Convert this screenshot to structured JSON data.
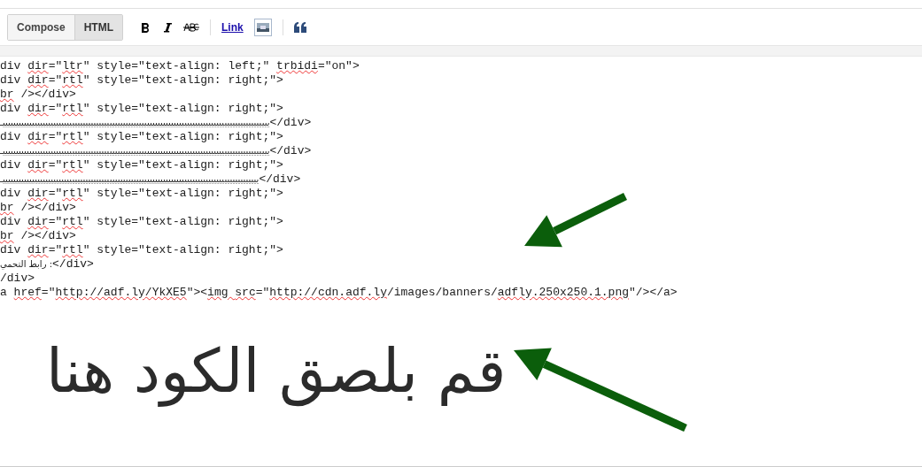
{
  "mode_tabs": [
    {
      "label": "Compose",
      "selected": false
    },
    {
      "label": "HTML",
      "selected": true
    }
  ],
  "toolbar": {
    "link": "Link"
  },
  "code_lines": [
    [
      {
        "text": "div "
      },
      {
        "text": "dir",
        "misspelled": true
      },
      {
        "text": "=\""
      },
      {
        "text": "ltr",
        "misspelled": true
      },
      {
        "text": "\" style=\"text-align: left;\" "
      },
      {
        "text": "trbidi",
        "misspelled": true
      },
      {
        "text": "=\"on\">"
      }
    ],
    [
      {
        "text": "div "
      },
      {
        "text": "dir",
        "misspelled": true
      },
      {
        "text": "=\""
      },
      {
        "text": "rtl",
        "misspelled": true
      },
      {
        "text": "\" style=\"text-align: right;\">"
      }
    ],
    [
      {
        "text": "br",
        "misspelled": true
      },
      {
        "text": " /></div>"
      }
    ],
    [
      {
        "text": "div "
      },
      {
        "text": "dir",
        "misspelled": true
      },
      {
        "text": "=\""
      },
      {
        "text": "rtl",
        "misspelled": true
      },
      {
        "text": "\" style=\"text-align: right;\">"
      }
    ],
    [
      {
        "text": "ییییییییییییییییییییییییییییییییییییییییییییییییییییییییییییییییییییییییییییییییییییییییییییییییییییـ",
        "kind": "arabic"
      },
      {
        "text": "</div>"
      }
    ],
    [
      {
        "text": "div "
      },
      {
        "text": "dir",
        "misspelled": true
      },
      {
        "text": "=\""
      },
      {
        "text": "rtl",
        "misspelled": true
      },
      {
        "text": "\" style=\"text-align: right;\">"
      }
    ],
    [
      {
        "text": "ییییییییییییییییییییییییییییییییییییییییییییییییییییییییییییییییییییییییییییییییییییییییییییییییییییـ",
        "kind": "arabic"
      },
      {
        "text": "</div>"
      }
    ],
    [
      {
        "text": "div "
      },
      {
        "text": "dir",
        "misspelled": true
      },
      {
        "text": "=\""
      },
      {
        "text": "rtl",
        "misspelled": true
      },
      {
        "text": "\" style=\"text-align: right;\">"
      }
    ],
    [
      {
        "text": "ییییییییییییییییییییییییییییییییییییییییییییییییییییییییییییییییییییییییییییییییییییییییییییییییـ",
        "kind": "arabic"
      },
      {
        "text": "</div>"
      }
    ],
    [
      {
        "text": "div "
      },
      {
        "text": "dir",
        "misspelled": true
      },
      {
        "text": "=\""
      },
      {
        "text": "rtl",
        "misspelled": true
      },
      {
        "text": "\" style=\"text-align: right;\">"
      }
    ],
    [
      {
        "text": "br",
        "misspelled": true
      },
      {
        "text": " /></div>"
      }
    ],
    [
      {
        "text": "div "
      },
      {
        "text": "dir",
        "misspelled": true
      },
      {
        "text": "=\""
      },
      {
        "text": "rtl",
        "misspelled": true
      },
      {
        "text": "\" style=\"text-align: right;\">"
      }
    ],
    [
      {
        "text": "br",
        "misspelled": true
      },
      {
        "text": " /></div>"
      }
    ],
    [
      {
        "text": "div "
      },
      {
        "text": "dir",
        "misspelled": true
      },
      {
        "text": "=\""
      },
      {
        "text": "rtl",
        "misspelled": true
      },
      {
        "text": "\" style=\"text-align: right;\">"
      }
    ],
    [
      {
        "text": "رابط التحمي :",
        "kind": "arabic"
      },
      {
        "text": "</div>"
      }
    ],
    [
      {
        "text": "/div>"
      }
    ],
    [
      {
        "text": "a "
      },
      {
        "text": "href",
        "misspelled": true
      },
      {
        "text": "=\""
      },
      {
        "text": "http://adf.ly/YkXE5",
        "misspelled": true
      },
      {
        "text": "\"><"
      },
      {
        "text": "img ",
        "misspelled": true
      },
      {
        "text": "src",
        "misspelled": true
      },
      {
        "text": "=\""
      },
      {
        "text": "http://cdn.adf.ly",
        "misspelled": true
      },
      {
        "text": "/images/banners/"
      },
      {
        "text": "adfly.250x250.1.png",
        "misspelled": true
      },
      {
        "text": "\"/></a>"
      }
    ]
  ],
  "annotation": "قم بلصق الكود هنا"
}
